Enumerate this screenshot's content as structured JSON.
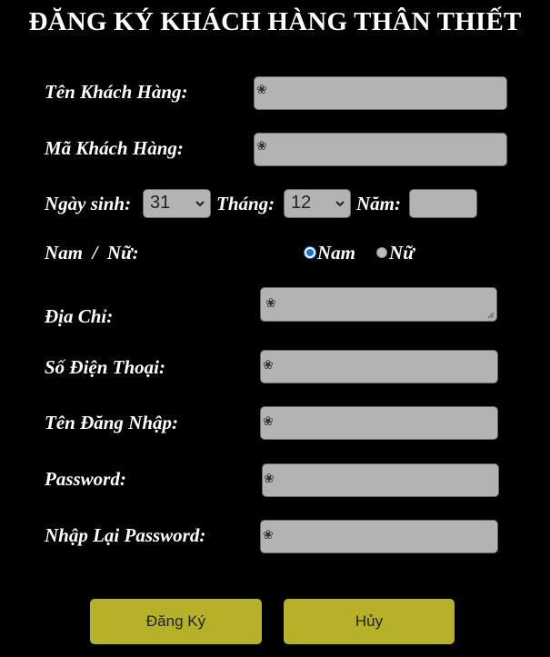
{
  "form": {
    "title": "ĐĂNG KÝ KHÁCH HÀNG THÂN THIẾT",
    "fields": {
      "customer_name": {
        "label": "Tên Khách Hàng:",
        "value": "",
        "icon": "flower-icon"
      },
      "customer_code": {
        "label": "Mã Khách Hàng:",
        "value": "",
        "icon": "flower-icon"
      },
      "address": {
        "label": "Địa Chỉ:",
        "value": "",
        "icon": "flower-icon"
      },
      "phone": {
        "label": "Số Điện Thoại:",
        "value": "",
        "icon": "flower-icon"
      },
      "username": {
        "label": "Tên Đăng Nhập:",
        "value": "",
        "icon": "flower-icon"
      },
      "password": {
        "label": "Password:",
        "value": "",
        "icon": "flower-icon"
      },
      "confirm_password": {
        "label": "Nhập Lại Password:",
        "value": "",
        "icon": "flower-icon"
      }
    },
    "birth": {
      "day_label": "Ngày sinh:",
      "day_value": "31",
      "month_label": "Tháng:",
      "month_value": "12",
      "year_label": "Năm:",
      "year_value": ""
    },
    "gender": {
      "label": "Nam  /  Nữ:",
      "options": [
        "Nam",
        "Nữ"
      ],
      "selected": "Nam"
    },
    "buttons": {
      "submit": "Đăng Ký",
      "cancel": "Hủy"
    }
  },
  "colors": {
    "background": "#000000",
    "input_bg": "#b3b3b3",
    "button_bg": "#b5b128",
    "radio_selected": "#1976d2"
  }
}
